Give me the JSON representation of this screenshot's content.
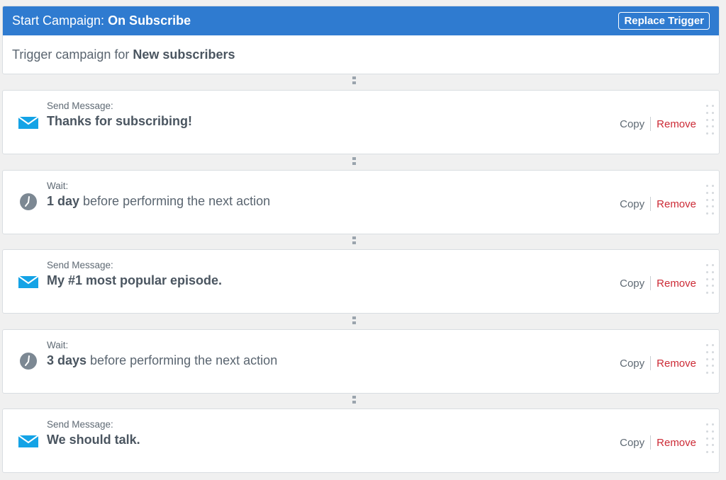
{
  "trigger": {
    "title_prefix": "Start Campaign: ",
    "title_event": "On Subscribe",
    "replace_label": "Replace Trigger",
    "body_prefix": "Trigger campaign for ",
    "body_target": "New subscribers"
  },
  "steps": [
    {
      "type": "message",
      "icon": "envelope-icon",
      "label": "Send Message:",
      "bold": "Thanks for subscribing!",
      "rest": ""
    },
    {
      "type": "wait",
      "icon": "clock-icon",
      "label": "Wait:",
      "bold": "1 day",
      "rest": " before performing the next action"
    },
    {
      "type": "message",
      "icon": "envelope-icon",
      "label": "Send Message:",
      "bold": "My #1 most popular episode.",
      "rest": ""
    },
    {
      "type": "wait",
      "icon": "clock-icon",
      "label": "Wait:",
      "bold": "3 days",
      "rest": " before performing the next action"
    },
    {
      "type": "message",
      "icon": "envelope-icon",
      "label": "Send Message:",
      "bold": "We should talk.",
      "rest": ""
    }
  ],
  "actions": {
    "copy_label": "Copy",
    "remove_label": "Remove"
  },
  "colors": {
    "header": "#2f7bd0",
    "remove": "#cc2a35",
    "envelope": "#14a3e6",
    "clock": "#7c8893"
  }
}
